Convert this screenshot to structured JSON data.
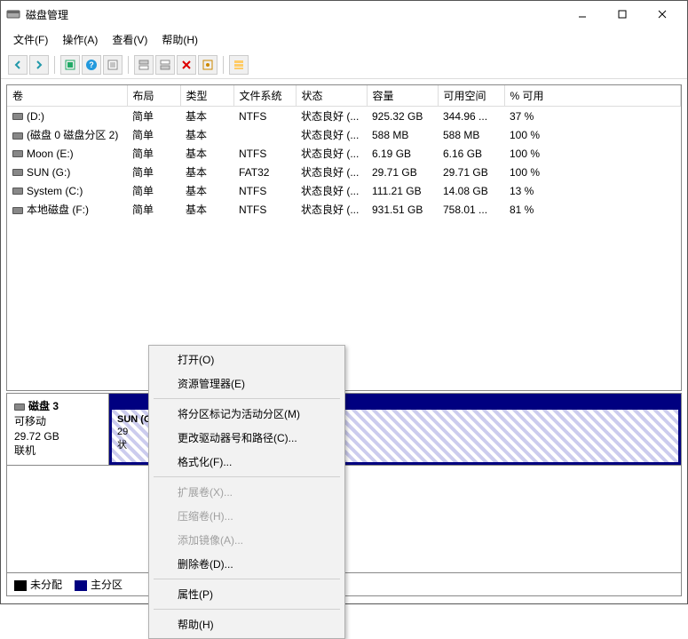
{
  "window": {
    "title": "磁盘管理"
  },
  "menu": {
    "file": "文件(F)",
    "action": "操作(A)",
    "view": "查看(V)",
    "help": "帮助(H)"
  },
  "columns": {
    "volume": "卷",
    "layout": "布局",
    "type": "类型",
    "filesystem": "文件系统",
    "status": "状态",
    "capacity": "容量",
    "free": "可用空间",
    "pctfree": "% 可用"
  },
  "rows": [
    {
      "volume": "(D:)",
      "layout": "简单",
      "type": "基本",
      "fs": "NTFS",
      "status": "状态良好 (...",
      "capacity": "925.32 GB",
      "free": "344.96 ...",
      "pct": "37 %"
    },
    {
      "volume": "(磁盘 0 磁盘分区 2)",
      "layout": "简单",
      "type": "基本",
      "fs": "",
      "status": "状态良好 (...",
      "capacity": "588 MB",
      "free": "588 MB",
      "pct": "100 %"
    },
    {
      "volume": "Moon (E:)",
      "layout": "简单",
      "type": "基本",
      "fs": "NTFS",
      "status": "状态良好 (...",
      "capacity": "6.19 GB",
      "free": "6.16 GB",
      "pct": "100 %"
    },
    {
      "volume": "SUN (G:)",
      "layout": "简单",
      "type": "基本",
      "fs": "FAT32",
      "status": "状态良好 (...",
      "capacity": "29.71 GB",
      "free": "29.71 GB",
      "pct": "100 %"
    },
    {
      "volume": "System (C:)",
      "layout": "简单",
      "type": "基本",
      "fs": "NTFS",
      "status": "状态良好 (...",
      "capacity": "111.21 GB",
      "free": "14.08 GB",
      "pct": "13 %"
    },
    {
      "volume": "本地磁盘 (F:)",
      "layout": "简单",
      "type": "基本",
      "fs": "NTFS",
      "status": "状态良好 (...",
      "capacity": "931.51 GB",
      "free": "758.01 ...",
      "pct": "81 %"
    }
  ],
  "disk": {
    "name": "磁盘 3",
    "rem": "可移动",
    "size": "29.72 GB",
    "online": "联机",
    "part_name": "SUN  (G:)",
    "part_size": "29",
    "part_status": "状"
  },
  "legend": {
    "unalloc": "未分配",
    "primary": "主分区"
  },
  "ctx": {
    "open": "打开(O)",
    "explorer": "资源管理器(E)",
    "markactive": "将分区标记为活动分区(M)",
    "changepath": "更改驱动器号和路径(C)...",
    "format": "格式化(F)...",
    "extend": "扩展卷(X)...",
    "shrink": "压缩卷(H)...",
    "mirror": "添加镜像(A)...",
    "delete": "删除卷(D)...",
    "properties": "属性(P)",
    "help": "帮助(H)"
  }
}
